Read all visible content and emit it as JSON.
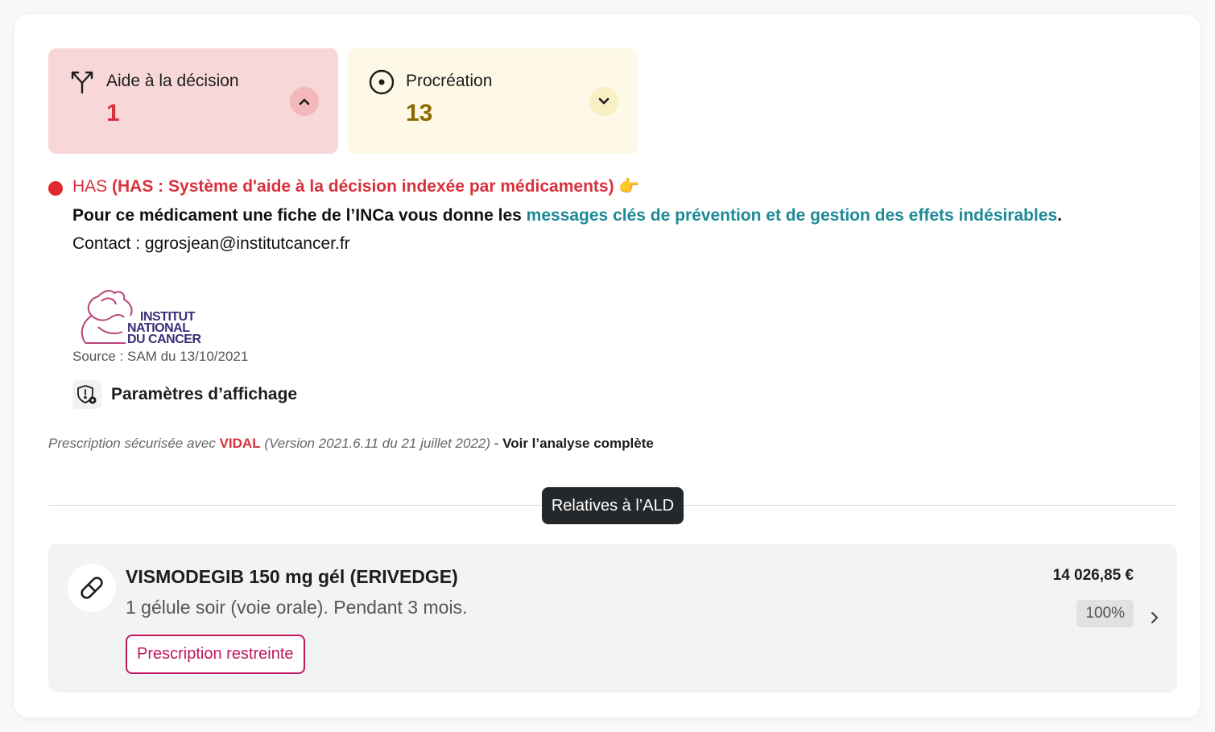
{
  "alerts": {
    "decision": {
      "title": "Aide à la décision",
      "count": "1",
      "icon": "fork-arrows-icon",
      "toggle_icon": "chevron-up-icon"
    },
    "procreation": {
      "title": "Procréation",
      "count": "13",
      "icon": "target-circle-icon",
      "toggle_icon": "chevron-down-icon"
    }
  },
  "has": {
    "prefix": "HAS ",
    "title": "(HAS : Système d'aide à la décision indexée par médicaments)",
    "emoji": "👉",
    "message_start": "Pour ce médicament une fiche de l’INCa vous donne les ",
    "message_link": "messages clés de prévention et de gestion des effets indésirables",
    "message_end": ".",
    "contact": "Contact : ggrosjean@institutcancer.fr",
    "logo_text": [
      "INSTITUT",
      "NATIONAL",
      "DU CANCER"
    ],
    "source": "Source : SAM du 13/10/2021"
  },
  "params": {
    "label": "Paramètres d’affichage",
    "icon": "shield-gear-icon"
  },
  "vidal": {
    "prefix": "Prescription sécurisée avec ",
    "brand": "VIDAL",
    "version": "(Version 2021.6.11 du 21 juillet 2022)",
    "separator": " - ",
    "link": "Voir l’analyse complète"
  },
  "section": {
    "badge": "Relatives à l’ALD"
  },
  "drug": {
    "name": "VISMODEGIB 150 mg gél (ERIVEDGE)",
    "dosage": "1 gélule soir (voie orale). Pendant 3 mois.",
    "badge": "Prescription restreinte",
    "price": "14 026,85 €",
    "rate": "100%",
    "icon": "pill-icon"
  },
  "colors": {
    "decision_bg": "#f8d7d8",
    "procreation_bg": "#fdf9e6",
    "alert_red": "#d8313c",
    "link_teal": "#1d8a96",
    "restricted_magenta": "#c0185f"
  }
}
